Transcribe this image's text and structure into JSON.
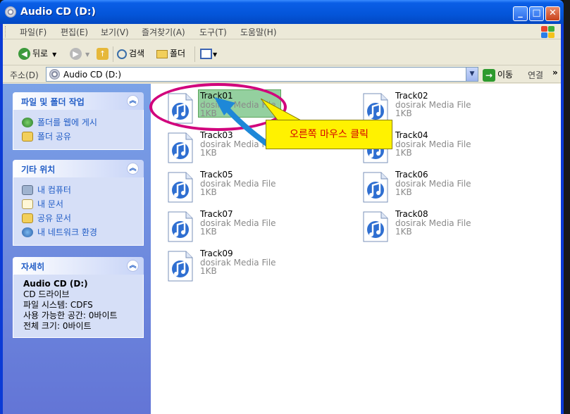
{
  "window": {
    "title": "Audio CD (D:)"
  },
  "menu": [
    "파일(F)",
    "편집(E)",
    "보기(V)",
    "즐겨찾기(A)",
    "도구(T)",
    "도움말(H)"
  ],
  "toolbar": {
    "back": "뒤로",
    "search": "검색",
    "folders": "폴더"
  },
  "address": {
    "label": "주소(D)",
    "value": "Audio CD (D:)",
    "go": "이동",
    "links": "연결"
  },
  "taskpane": {
    "file_tasks": {
      "title": "파일 및 폴더 작업",
      "items": [
        "폴더를 웹에 게시",
        "폴더 공유"
      ]
    },
    "other_places": {
      "title": "기타 위치",
      "items": [
        "내 컴퓨터",
        "내 문서",
        "공유 문서",
        "내 네트워크 환경"
      ]
    },
    "details": {
      "title": "자세히",
      "name": "Audio CD (D:)",
      "lines": [
        "CD 드라이브",
        "파일 시스템: CDFS",
        "사용 가능한 공간: 0바이트",
        "전체 크기: 0바이트"
      ]
    }
  },
  "files": [
    {
      "name": "Track01",
      "type": "dosirak Media File",
      "size": "1KB",
      "selected": true
    },
    {
      "name": "Track02",
      "type": "dosirak Media File",
      "size": "1KB"
    },
    {
      "name": "Track03",
      "type": "dosirak Media File",
      "size": "1KB"
    },
    {
      "name": "Track04",
      "type": "dosirak Media File",
      "size": "1KB"
    },
    {
      "name": "Track05",
      "type": "dosirak Media File",
      "size": "1KB"
    },
    {
      "name": "Track06",
      "type": "dosirak Media File",
      "size": "1KB"
    },
    {
      "name": "Track07",
      "type": "dosirak Media File",
      "size": "1KB"
    },
    {
      "name": "Track08",
      "type": "dosirak Media File",
      "size": "1KB"
    },
    {
      "name": "Track09",
      "type": "dosirak Media File",
      "size": "1KB"
    }
  ],
  "annotation": {
    "callout_text": "오른쪽 마우스 클릭"
  },
  "colors": {
    "annotation_ring": "#d1007c",
    "callout_bg": "#fff200",
    "callout_text": "#d40000",
    "arrow": "#1e88d8"
  }
}
